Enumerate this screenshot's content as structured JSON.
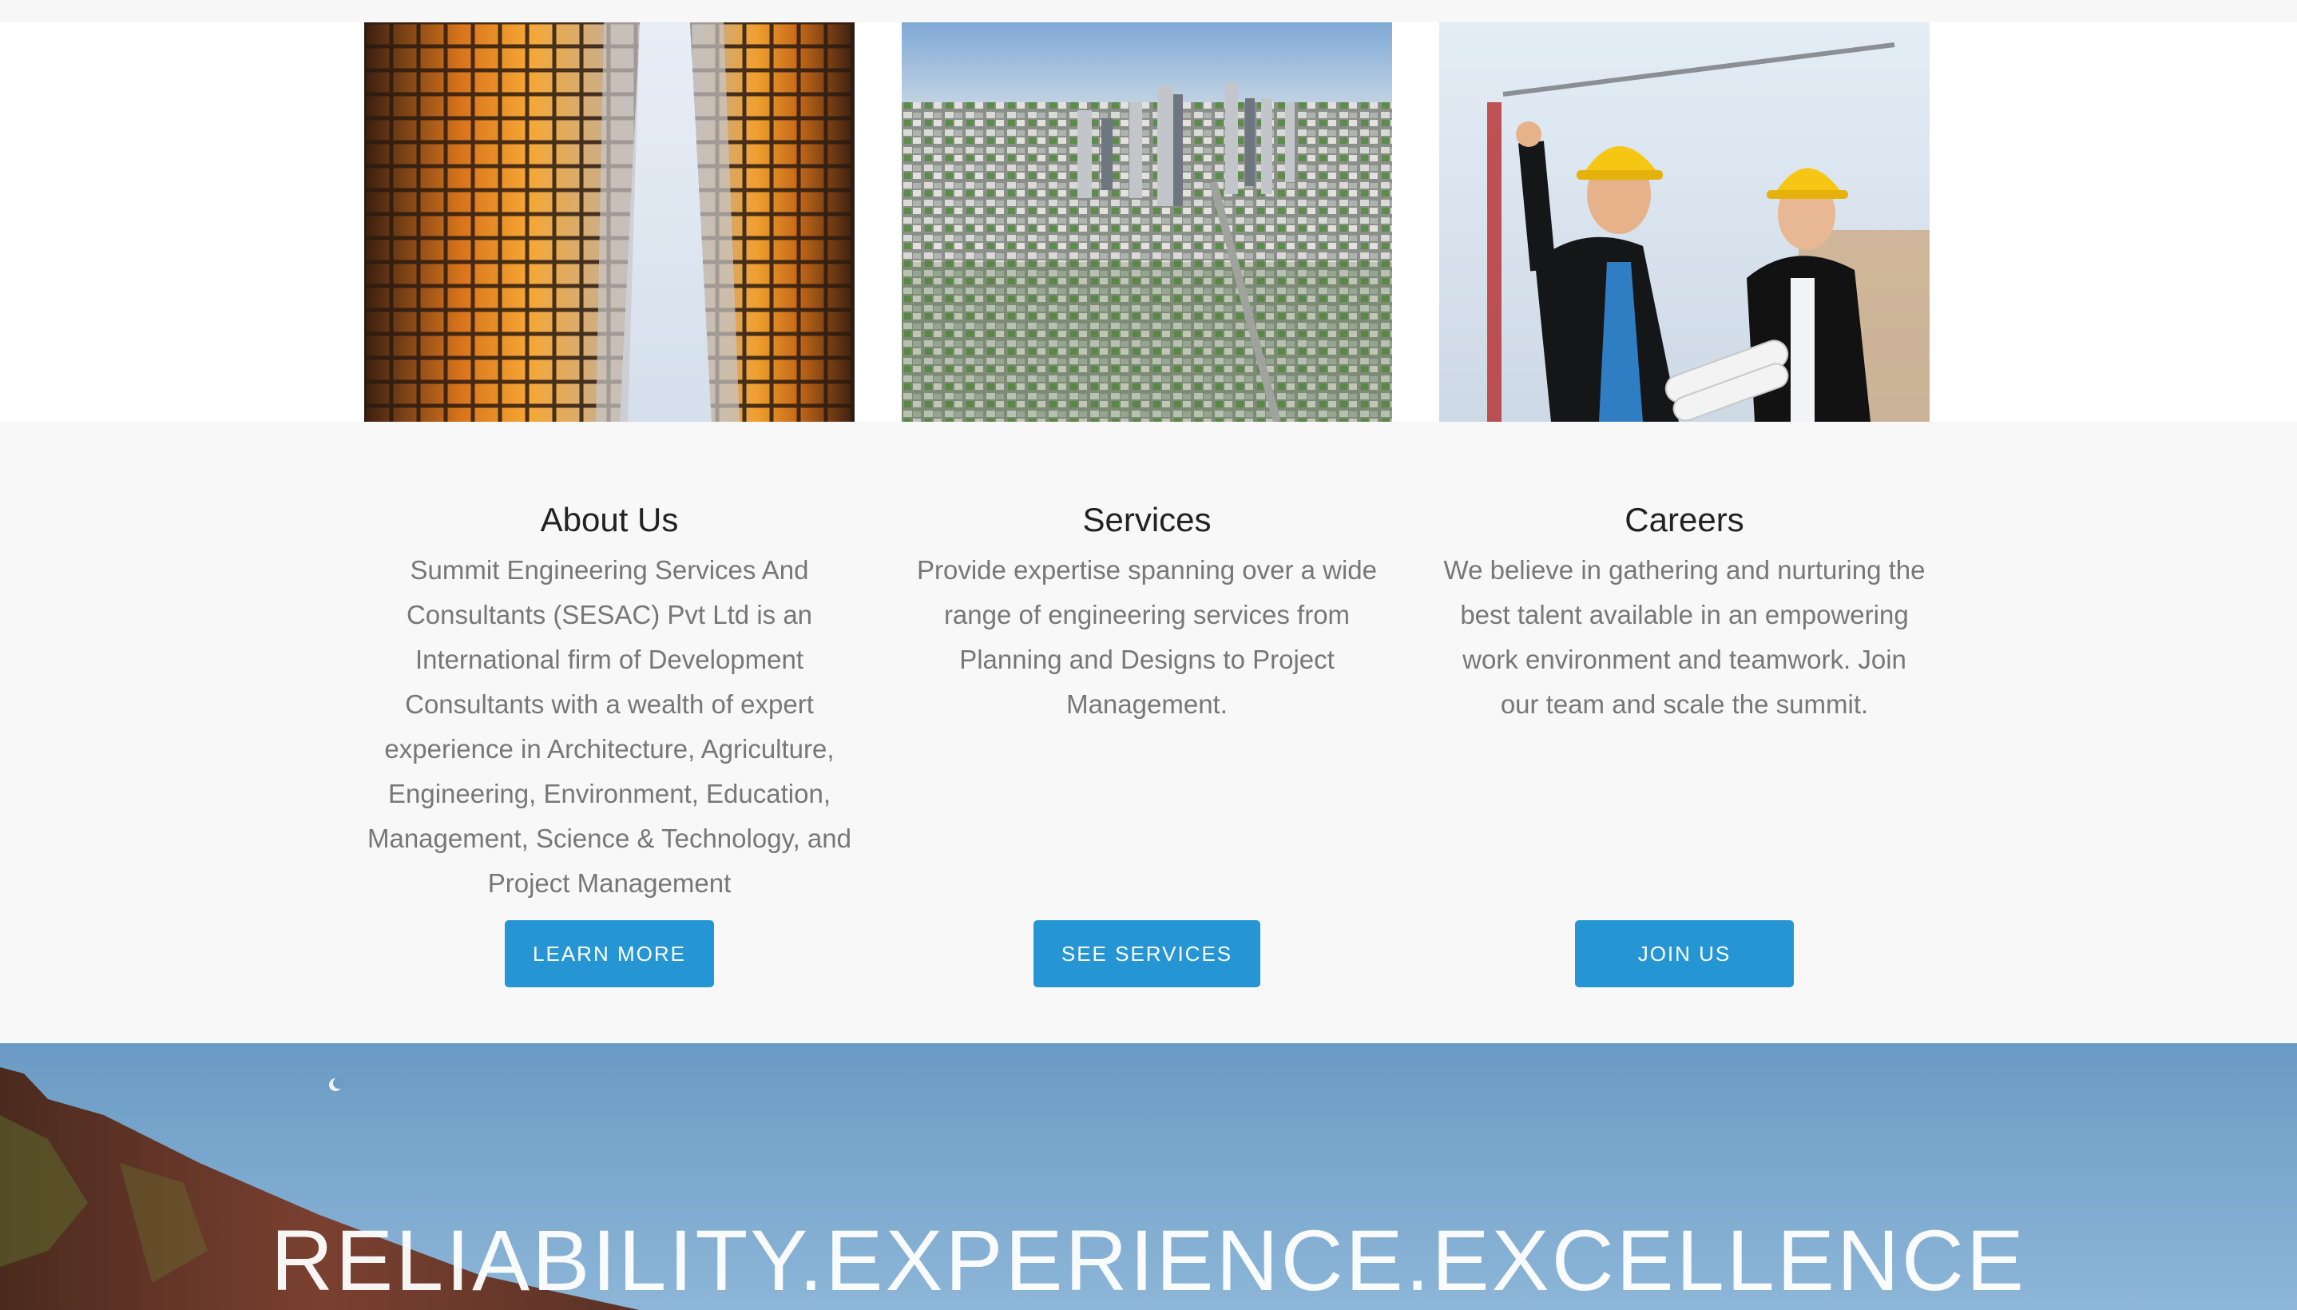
{
  "cards": [
    {
      "image": "reflective-skyscrapers-photo",
      "title": "About Us",
      "text": "Summit Engineering Services And Consultants (SESAC) Pvt Ltd is an International firm of Development Consultants with a wealth of expert experience in Architecture, Agriculture, Engineering, Environment, Education, Management, Science & Technology, and Project Management",
      "button": "LEARN MORE"
    },
    {
      "image": "city-aerial-photo",
      "title": "Services",
      "text": "Provide expertise spanning over a wide range of engineering services from Planning and Designs to Project Management.",
      "button": "SEE SERVICES"
    },
    {
      "image": "engineers-hardhats-photo",
      "title": "Careers",
      "text": "We believe in gathering and nurturing the best talent available in an empowering work environment and teamwork. Join our team and scale the summit.",
      "button": "JOIN US"
    }
  ],
  "hero": {
    "image": "cliff-sky-photo",
    "tagline": "RELIABILITY.EXPERIENCE.EXCELLENCE"
  },
  "colors": {
    "button": "#2596d3",
    "heading": "#222222",
    "body_text": "#777777",
    "section_bg": "#f8f8f8"
  }
}
